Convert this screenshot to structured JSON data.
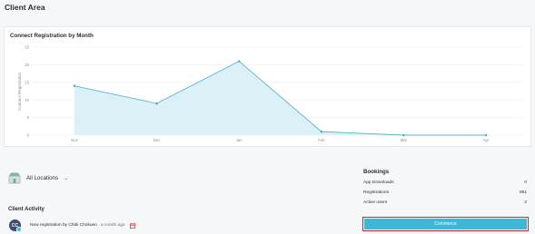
{
  "page": {
    "title": "Client Area"
  },
  "chart_data": {
    "type": "area",
    "title": "Connect Registration by Month",
    "ylabel": "Connect Registration",
    "xlabel": "",
    "categories": [
      "Nov",
      "Dec",
      "Jan",
      "Feb",
      "Mar",
      "Apr"
    ],
    "series": [
      {
        "values": [
          14,
          9,
          21,
          1,
          0,
          0
        ]
      }
    ],
    "ylim": [
      0,
      25
    ],
    "yticks": [
      0,
      5,
      10,
      15,
      20,
      25
    ],
    "grid": true,
    "colors": {
      "line": "#5ab3d1",
      "fill": "#dcf0f8",
      "point": "#4fb6b0"
    }
  },
  "location": {
    "label": "All Locations",
    "icon": "chevron-down-icon"
  },
  "client_activity": {
    "title": "Client Activity",
    "items": [
      {
        "avatar": "CC",
        "text": "New registration by Chibi Chokuen",
        "time": "a month ago"
      }
    ]
  },
  "bookings": {
    "title": "Bookings",
    "rows": [
      {
        "label": "App Downloads",
        "value": "0"
      },
      {
        "label": "Registrations",
        "value": "951"
      },
      {
        "label": "Active users",
        "value": "2"
      }
    ]
  },
  "button": {
    "label": "Commerce"
  },
  "colors": {
    "accent": "#3eb8d6",
    "highlight_border": "#d2232a"
  }
}
